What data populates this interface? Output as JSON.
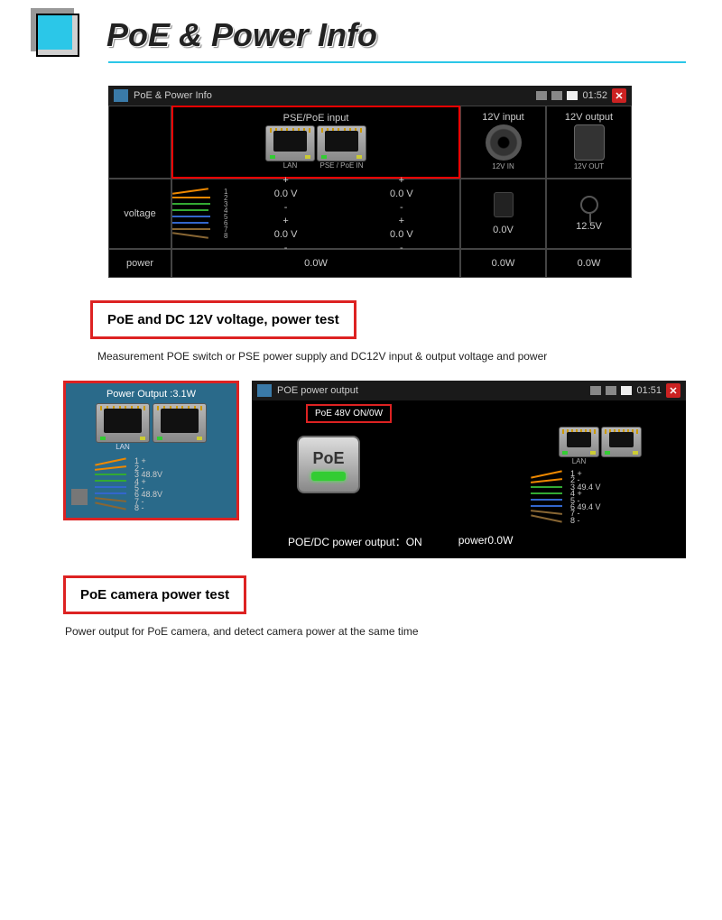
{
  "header": {
    "title": "PoE & Power Info"
  },
  "screen1": {
    "title": "PoE & Power Info",
    "time": "01:52",
    "cols": {
      "pse": "PSE/PoE input",
      "in12": "12V input",
      "out12": "12V output"
    },
    "port_lan": "LAN",
    "port_pse": "PSE / PoE IN",
    "port_12in": "12V IN",
    "port_12out": "12V OUT",
    "row_voltage": "voltage",
    "row_power": "power",
    "pse_v": [
      "+",
      "+",
      "0.0 V",
      "0.0 V",
      "-",
      "-",
      "+",
      "+",
      "0.0 V",
      "0.0 V",
      "-",
      "-"
    ],
    "in12_v": "0.0V",
    "out12_v": "12.5V",
    "pse_p": "0.0W",
    "in12_p": "0.0W",
    "out12_p": "0.0W"
  },
  "callout1": "PoE and DC 12V voltage, power test",
  "desc1": "Measurement POE switch or PSE power supply and DC12V input & output voltage and power",
  "side": {
    "output": "Power Output :3.1W",
    "lan": "LAN",
    "pins": [
      "1 +",
      "2 -",
      "3  48.8V",
      "4 +",
      "5 -",
      "6  48.8V",
      "7 -",
      "8 -"
    ]
  },
  "screen2": {
    "title": "POE power output",
    "time": "01:51",
    "badge": "PoE 48V ON/0W",
    "btn": "PoE",
    "lan": "LAN",
    "pins": [
      "1 +",
      "2 -",
      "3  49.4 V",
      "4 +",
      "5 -",
      "6  49.4 V",
      "7 -",
      "8 -"
    ],
    "bottom_left": "POE/DC power output：ON",
    "bottom_right": "power0.0W"
  },
  "callout2": "PoE camera power test",
  "desc2": "Power output for PoE camera, and detect camera power at the same time"
}
